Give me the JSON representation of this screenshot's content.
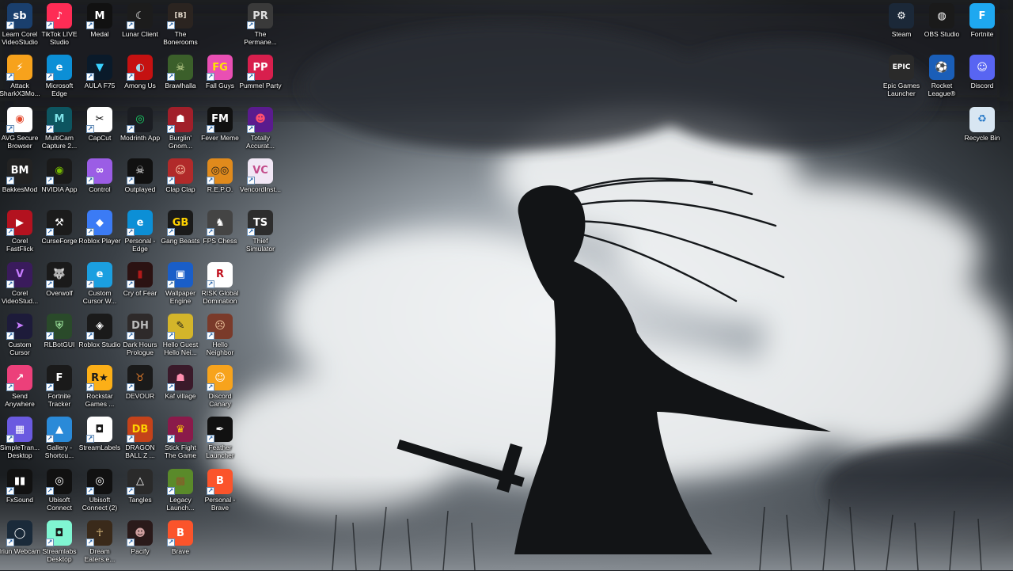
{
  "desktop": {
    "icons": [
      {
        "label": "Learn Corel VideoStudio",
        "icon": "corel-training-icon",
        "glyph": "sb",
        "bg": "#1a3f6d",
        "fg": "#ffffff",
        "col": 0,
        "row": 0
      },
      {
        "label": "TikTok LIVE Studio",
        "icon": "tiktok-icon",
        "glyph": "♪",
        "bg": "#fe2c55",
        "fg": "#ffffff",
        "col": 1,
        "row": 0
      },
      {
        "label": "Medal",
        "icon": "medal-icon",
        "glyph": "M",
        "bg": "#111111",
        "fg": "#ffffff",
        "col": 2,
        "row": 0
      },
      {
        "label": "Lunar Client",
        "icon": "lunar-client-icon",
        "glyph": "☾",
        "bg": "#1c1c1c",
        "fg": "#ffffff",
        "col": 3,
        "row": 0
      },
      {
        "label": "The Bonerooms",
        "icon": "bonerooms-icon",
        "glyph": "[B]",
        "bg": "#2b2420",
        "fg": "#e0d6c8",
        "col": 4,
        "row": 0
      },
      {
        "label": "The Permane...",
        "icon": "permanent-residence-icon",
        "glyph": "PR",
        "bg": "#3a3a3a",
        "fg": "#dddddd",
        "col": 6,
        "row": 0
      },
      {
        "label": "Attack SharkX3Mo...",
        "icon": "attack-shark-icon",
        "glyph": "⚡",
        "bg": "#f7a21c",
        "fg": "#ffffff",
        "col": 0,
        "row": 1
      },
      {
        "label": "Microsoft Edge",
        "icon": "edge-icon",
        "glyph": "e",
        "bg": "#0c8fd6",
        "fg": "#ffffff",
        "col": 1,
        "row": 1
      },
      {
        "label": "AULA F75",
        "icon": "aula-icon",
        "glyph": "▼",
        "bg": "#0a1a2a",
        "fg": "#3ad1ff",
        "col": 2,
        "row": 1
      },
      {
        "label": "Among Us",
        "icon": "among-us-icon",
        "glyph": "◐",
        "bg": "#c51111",
        "fg": "#9fd8ea",
        "col": 3,
        "row": 1
      },
      {
        "label": "Brawlhalla",
        "icon": "brawlhalla-icon",
        "glyph": "☠",
        "bg": "#3b5f2a",
        "fg": "#d8e6a0",
        "col": 4,
        "row": 1
      },
      {
        "label": "Fall Guys",
        "icon": "fall-guys-icon",
        "glyph": "FG",
        "bg": "#e94fb3",
        "fg": "#ffe600",
        "col": 5,
        "row": 1
      },
      {
        "label": "Pummel Party",
        "icon": "pummel-party-icon",
        "glyph": "PP",
        "bg": "#d81f4d",
        "fg": "#ffffff",
        "col": 6,
        "row": 1
      },
      {
        "label": "AVG Secure Browser",
        "icon": "avg-browser-icon",
        "glyph": "◉",
        "bg": "#ffffff",
        "fg": "#e4472b",
        "col": 0,
        "row": 2
      },
      {
        "label": "MultiCam Capture 2...",
        "icon": "multicam-icon",
        "glyph": "M",
        "bg": "#0d5560",
        "fg": "#7fe3e8",
        "col": 1,
        "row": 2
      },
      {
        "label": "CapCut",
        "icon": "capcut-icon",
        "glyph": "✂",
        "bg": "#ffffff",
        "fg": "#000000",
        "col": 2,
        "row": 2
      },
      {
        "label": "Modrinth App",
        "icon": "modrinth-icon",
        "glyph": "◎",
        "bg": "#1b1d22",
        "fg": "#1bd96a",
        "col": 3,
        "row": 2
      },
      {
        "label": "Burglin' Gnom...",
        "icon": "burglin-gnomes-icon",
        "glyph": "☗",
        "bg": "#a11f2a",
        "fg": "#ffffff",
        "col": 4,
        "row": 2
      },
      {
        "label": "Fever Meme",
        "icon": "fever-meme-icon",
        "glyph": "FM",
        "bg": "#111111",
        "fg": "#ffffff",
        "col": 5,
        "row": 2
      },
      {
        "label": "Totally Accurat...",
        "icon": "tabs-icon",
        "glyph": "☻",
        "bg": "#5a1b8e",
        "fg": "#ff4f6e",
        "col": 6,
        "row": 2
      },
      {
        "label": "BakkesMod",
        "icon": "bakkesmod-icon",
        "glyph": "BM",
        "bg": "#222222",
        "fg": "#ffffff",
        "col": 0,
        "row": 3
      },
      {
        "label": "NVIDIA App",
        "icon": "nvidia-icon",
        "glyph": "◉",
        "bg": "#1a1a1a",
        "fg": "#76b900",
        "col": 1,
        "row": 3
      },
      {
        "label": "Control",
        "icon": "control-icon",
        "glyph": "∞",
        "bg": "#9b5de5",
        "fg": "#ffffff",
        "col": 2,
        "row": 3
      },
      {
        "label": "Outplayed",
        "icon": "outplayed-icon",
        "glyph": "☠",
        "bg": "#111111",
        "fg": "#ffffff",
        "col": 3,
        "row": 3
      },
      {
        "label": "Clap Clap",
        "icon": "clap-clap-icon",
        "glyph": "☺",
        "bg": "#b12a2a",
        "fg": "#ffd2b0",
        "col": 4,
        "row": 3
      },
      {
        "label": "R.E.P.O.",
        "icon": "repo-icon",
        "glyph": "◎◎",
        "bg": "#e08a1c",
        "fg": "#1a1a1a",
        "col": 5,
        "row": 3
      },
      {
        "label": "VencordInst...",
        "icon": "vencord-icon",
        "glyph": "VC",
        "bg": "#f1e7f5",
        "fg": "#c34b8a",
        "col": 6,
        "row": 3
      },
      {
        "label": "Corel FastFlick",
        "icon": "fastflick-icon",
        "glyph": "▶",
        "bg": "#b3121f",
        "fg": "#ffffff",
        "col": 0,
        "row": 4
      },
      {
        "label": "CurseForge",
        "icon": "curseforge-icon",
        "glyph": "⚒",
        "bg": "#1b1b1b",
        "fg": "#ffffff",
        "col": 1,
        "row": 4
      },
      {
        "label": "Roblox Player",
        "icon": "roblox-player-icon",
        "glyph": "◆",
        "bg": "#3b7bf5",
        "fg": "#ffffff",
        "col": 2,
        "row": 4
      },
      {
        "label": "Personal - Edge",
        "icon": "edge-profile-icon",
        "glyph": "e",
        "bg": "#0c8fd6",
        "fg": "#ffffff",
        "col": 3,
        "row": 4
      },
      {
        "label": "Gang Beasts",
        "icon": "gang-beasts-icon",
        "glyph": "GB",
        "bg": "#1a1a1a",
        "fg": "#ffd200",
        "col": 4,
        "row": 4
      },
      {
        "label": "FPS Chess",
        "icon": "fps-chess-icon",
        "glyph": "♞",
        "bg": "#444444",
        "fg": "#ffffff",
        "col": 5,
        "row": 4
      },
      {
        "label": "Thief Simulator",
        "icon": "thief-simulator-icon",
        "glyph": "TS",
        "bg": "#2d2d2d",
        "fg": "#ffffff",
        "col": 6,
        "row": 4
      },
      {
        "label": "Corel VideoStud...",
        "icon": "corel-videostudio-icon",
        "glyph": "V",
        "bg": "#3a1b5c",
        "fg": "#c77dff",
        "col": 0,
        "row": 5
      },
      {
        "label": "Overwolf",
        "icon": "overwolf-icon",
        "glyph": "🐺",
        "bg": "#1a1a1a",
        "fg": "#ffffff",
        "col": 1,
        "row": 5
      },
      {
        "label": "Custom Cursor W...",
        "icon": "custom-cursor-web-icon",
        "glyph": "e",
        "bg": "#1b9fe0",
        "fg": "#ffffff",
        "col": 2,
        "row": 5
      },
      {
        "label": "Cry of Fear",
        "icon": "cry-of-fear-icon",
        "glyph": "▮",
        "bg": "#2b1212",
        "fg": "#b11a1a",
        "col": 3,
        "row": 5
      },
      {
        "label": "Wallpaper Engine",
        "icon": "wallpaper-engine-icon",
        "glyph": "▣",
        "bg": "#1a5ec8",
        "fg": "#ffffff",
        "col": 4,
        "row": 5
      },
      {
        "label": "RISK Global Domination",
        "icon": "risk-icon",
        "glyph": "R",
        "bg": "#ffffff",
        "fg": "#c1121f",
        "col": 5,
        "row": 5
      },
      {
        "label": "Custom Cursor",
        "icon": "custom-cursor-icon",
        "glyph": "➤",
        "bg": "#1d1b3a",
        "fg": "#c77dff",
        "col": 0,
        "row": 6
      },
      {
        "label": "RLBotGUI",
        "icon": "rlbotgui-icon",
        "glyph": "⛨",
        "bg": "#2a4a2a",
        "fg": "#8fd18f",
        "col": 1,
        "row": 6
      },
      {
        "label": "Roblox Studio",
        "icon": "roblox-studio-icon",
        "glyph": "◈",
        "bg": "#1a1a1a",
        "fg": "#ffffff",
        "col": 2,
        "row": 6
      },
      {
        "label": "Dark Hours Prologue",
        "icon": "dark-hours-icon",
        "glyph": "DH",
        "bg": "#2e2a2a",
        "fg": "#bbbbbb",
        "col": 3,
        "row": 6
      },
      {
        "label": "Hello Guest Hello Nei...",
        "icon": "hello-guest-icon",
        "glyph": "✎",
        "bg": "#d4b52a",
        "fg": "#1a1a1a",
        "col": 4,
        "row": 6
      },
      {
        "label": "Hello Neighbor",
        "icon": "hello-neighbor-icon",
        "glyph": "☹",
        "bg": "#7a3a2a",
        "fg": "#f0c8a0",
        "col": 5,
        "row": 6
      },
      {
        "label": "Send Anywhere",
        "icon": "send-anywhere-icon",
        "glyph": "↗",
        "bg": "#ec407a",
        "fg": "#ffffff",
        "col": 0,
        "row": 7
      },
      {
        "label": "Fortnite Tracker",
        "icon": "fortnite-tracker-icon",
        "glyph": "F",
        "bg": "#1a1a1a",
        "fg": "#ffffff",
        "col": 1,
        "row": 7
      },
      {
        "label": "Rockstar Games ...",
        "icon": "rockstar-icon",
        "glyph": "R★",
        "bg": "#fcaf17",
        "fg": "#1a1a1a",
        "col": 2,
        "row": 7
      },
      {
        "label": "DEVOUR",
        "icon": "devour-icon",
        "glyph": "♉",
        "bg": "#1a1a1a",
        "fg": "#e07a2a",
        "col": 3,
        "row": 7
      },
      {
        "label": "Kaf village",
        "icon": "kaf-village-icon",
        "glyph": "☗",
        "bg": "#3a1a2a",
        "fg": "#ff8fb0",
        "col": 4,
        "row": 7
      },
      {
        "label": "Discord Canary",
        "icon": "discord-canary-icon",
        "glyph": "☺",
        "bg": "#f7a31c",
        "fg": "#ffffff",
        "col": 5,
        "row": 7
      },
      {
        "label": "SimpleTran... Desktop",
        "icon": "simpletransfer-icon",
        "glyph": "▦",
        "bg": "#6a5ae0",
        "fg": "#ffffff",
        "col": 0,
        "row": 8
      },
      {
        "label": "Gallery - Shortcu...",
        "icon": "gallery-icon",
        "glyph": "▲",
        "bg": "#2a8ad8",
        "fg": "#ffffff",
        "col": 1,
        "row": 8
      },
      {
        "label": "StreamLabels",
        "icon": "streamlabels-icon",
        "glyph": "◘",
        "bg": "#ffffff",
        "fg": "#1a1a1a",
        "col": 2,
        "row": 8
      },
      {
        "label": "DRAGON BALL Z ...",
        "icon": "dragon-ball-icon",
        "glyph": "DB",
        "bg": "#c4421a",
        "fg": "#ffd200",
        "col": 3,
        "row": 8
      },
      {
        "label": "Stick Fight The Game",
        "icon": "stick-fight-icon",
        "glyph": "♛",
        "bg": "#8a1a4a",
        "fg": "#ffd200",
        "col": 4,
        "row": 8
      },
      {
        "label": "Feather Launcher",
        "icon": "feather-icon",
        "glyph": "✒",
        "bg": "#111111",
        "fg": "#ffffff",
        "col": 5,
        "row": 8
      },
      {
        "label": "FxSound",
        "icon": "fxsound-icon",
        "glyph": "▮▮",
        "bg": "#111111",
        "fg": "#ffffff",
        "col": 0,
        "row": 9
      },
      {
        "label": "Ubisoft Connect",
        "icon": "ubisoft-icon",
        "glyph": "◎",
        "bg": "#111111",
        "fg": "#ffffff",
        "col": 1,
        "row": 9
      },
      {
        "label": "Ubisoft Connect (2)",
        "icon": "ubisoft-2-icon",
        "glyph": "◎",
        "bg": "#111111",
        "fg": "#ffffff",
        "col": 2,
        "row": 9
      },
      {
        "label": "Tangles",
        "icon": "tangles-icon",
        "glyph": "△",
        "bg": "#2a2a2a",
        "fg": "#ffffff",
        "col": 3,
        "row": 9
      },
      {
        "label": "Legacy Launch...",
        "icon": "minecraft-legacy-icon",
        "glyph": "▩",
        "bg": "#5a8a2a",
        "fg": "#8a5a2a",
        "col": 4,
        "row": 9
      },
      {
        "label": "Personal - Brave",
        "icon": "brave-profile-icon",
        "glyph": "B",
        "bg": "#fb542b",
        "fg": "#ffffff",
        "col": 5,
        "row": 9
      },
      {
        "label": "Iriun Webcam",
        "icon": "iriun-webcam-icon",
        "glyph": "◯",
        "bg": "#1a2a3a",
        "fg": "#ffffff",
        "col": 0,
        "row": 10
      },
      {
        "label": "Streamlabs Desktop",
        "icon": "streamlabs-icon",
        "glyph": "◘",
        "bg": "#80f5d2",
        "fg": "#1a1a1a",
        "col": 1,
        "row": 10
      },
      {
        "label": "Dream Eaters.e...",
        "icon": "dream-eaters-icon",
        "glyph": "☥",
        "bg": "#3a2a1a",
        "fg": "#e0c080",
        "col": 2,
        "row": 10
      },
      {
        "label": "Pacify",
        "icon": "pacify-icon",
        "glyph": "☻",
        "bg": "#2a1a1a",
        "fg": "#d0a0a0",
        "col": 3,
        "row": 10
      },
      {
        "label": "Brave",
        "icon": "brave-icon",
        "glyph": "B",
        "bg": "#fb542b",
        "fg": "#ffffff",
        "col": 4,
        "row": 10
      },
      {
        "label": "Steam",
        "icon": "steam-icon",
        "glyph": "⚙",
        "bg": "#1b2838",
        "fg": "#ffffff",
        "rcol": 2,
        "row": 0
      },
      {
        "label": "OBS Studio",
        "icon": "obs-icon",
        "glyph": "◍",
        "bg": "#1a1a1a",
        "fg": "#ffffff",
        "rcol": 1,
        "row": 0
      },
      {
        "label": "Fortnite",
        "icon": "fortnite-icon",
        "glyph": "F",
        "bg": "#1ea8f0",
        "fg": "#ffffff",
        "rcol": 0,
        "row": 0
      },
      {
        "label": "Epic Games Launcher",
        "icon": "epic-games-icon",
        "glyph": "EPIC",
        "bg": "#2a2a2a",
        "fg": "#ffffff",
        "rcol": 2,
        "row": 1
      },
      {
        "label": "Rocket League®",
        "icon": "rocket-league-icon",
        "glyph": "⚽",
        "bg": "#1a5eb8",
        "fg": "#ffffff",
        "rcol": 1,
        "row": 1
      },
      {
        "label": "Discord",
        "icon": "discord-icon",
        "glyph": "☺",
        "bg": "#5865f2",
        "fg": "#ffffff",
        "rcol": 0,
        "row": 1
      },
      {
        "label": "Recycle Bin",
        "icon": "recycle-bin-icon",
        "glyph": "♻",
        "bg": "#d8e6f2",
        "fg": "#2a7ac8",
        "rcol": 0,
        "row": 2
      }
    ]
  },
  "colors": {
    "sky_dark": "#1d2125",
    "cloud": "#dfe3e6",
    "silhouette": "#111315"
  }
}
